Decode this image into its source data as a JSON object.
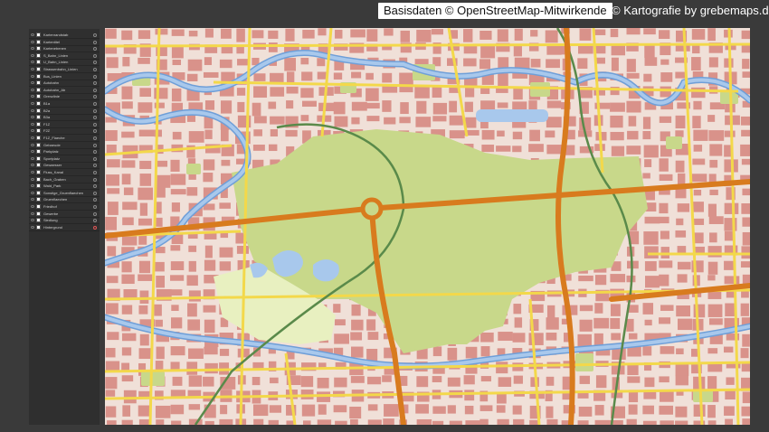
{
  "credits": {
    "osm": "Basisdaten © OpenStreetMap-Mitwirkende",
    "cartography": "© Kartografie by grebemaps.de"
  },
  "layers_panel": {
    "items": [
      {
        "label": "Kartenrandstab",
        "swatch": "#ffffff"
      },
      {
        "label": "Kartentitel",
        "swatch": "#ffffff"
      },
      {
        "label": "Kartenebenen",
        "swatch": "#ffffff"
      },
      {
        "label": "S_Bahn_Linien",
        "swatch": "#ffffff"
      },
      {
        "label": "U_Bahn_Linien",
        "swatch": "#ffffff"
      },
      {
        "label": "Strassenbahn_Linien",
        "swatch": "#ffffff"
      },
      {
        "label": "Bus_Linien",
        "swatch": "#ffffff"
      },
      {
        "label": "Autobahn",
        "swatch": "#ffffff"
      },
      {
        "label": "Autobahn_Ab",
        "swatch": "#ffffff"
      },
      {
        "label": "Grenzlinie",
        "swatch": "#ffffff"
      },
      {
        "label": "B1a",
        "swatch": "#ffffff"
      },
      {
        "label": "B2a",
        "swatch": "#ffffff"
      },
      {
        "label": "B3a",
        "swatch": "#ffffff"
      },
      {
        "label": "F1Z",
        "swatch": "#ffffff"
      },
      {
        "label": "F2Z",
        "swatch": "#ffffff"
      },
      {
        "label": "F1Z_Flaeche",
        "swatch": "#ffffff"
      },
      {
        "label": "Gebaeude",
        "swatch": "#ffffff"
      },
      {
        "label": "Parkplatz",
        "swatch": "#ffffff"
      },
      {
        "label": "Sportplatz",
        "swatch": "#ffffff"
      },
      {
        "label": "Gewaesser",
        "swatch": "#ffffff"
      },
      {
        "label": "Fluss_Kanal",
        "swatch": "#ffffff"
      },
      {
        "label": "Bach_Graben",
        "swatch": "#ffffff"
      },
      {
        "label": "Wald_Park",
        "swatch": "#ffffff"
      },
      {
        "label": "Sonstige_Gruenflaechen",
        "swatch": "#ffffff"
      },
      {
        "label": "Gruenflaechen",
        "swatch": "#ffffff"
      },
      {
        "label": "Friedhof",
        "swatch": "#ffffff"
      },
      {
        "label": "Gewerbe",
        "swatch": "#ffffff"
      },
      {
        "label": "Siedlung",
        "swatch": "#ffffff"
      },
      {
        "label": "Hintergrund",
        "swatch": "#ffffff"
      }
    ],
    "selected_index": 28
  },
  "map": {
    "colors": {
      "background": "#f0e0d8",
      "building": "#d9928a",
      "park": "#c8d88a",
      "green_light": "#e8f0c0",
      "water": "#a8c8ec",
      "river": "#6f9fd8",
      "main_road": "#d87b1e",
      "road_yellow": "#f3d84a",
      "road_white": "#ffffff",
      "rail": "#5a8a4a"
    }
  }
}
